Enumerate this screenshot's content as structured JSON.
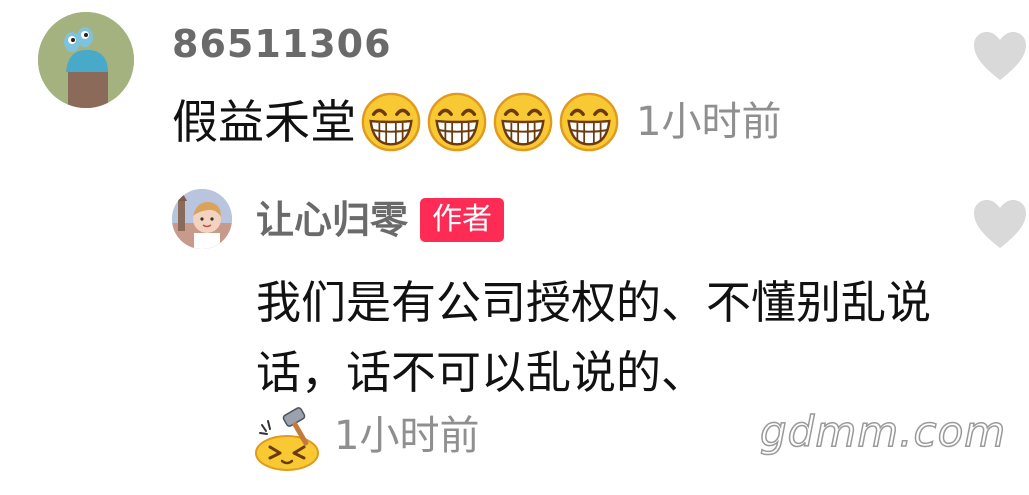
{
  "comment": {
    "username": "86511306",
    "text": "假益禾堂",
    "emoji_count": 4,
    "emoji_icon": "grinning-face-icon",
    "time": "1小时前",
    "like_icon": "heart-icon"
  },
  "reply": {
    "username": "让心归零",
    "author_badge": "作者",
    "text": "我们是有公司授权的、不懂别乱说话，话不可以乱说的、",
    "emoji_icon": "hammer-bonk-face-icon",
    "time": "1小时前",
    "like_icon": "heart-icon"
  },
  "watermark": "gdmm.com",
  "colors": {
    "username": "#6a6a6a",
    "time": "#8f8f8f",
    "badge": "#fe2c55",
    "heart": "#d9d9d9"
  }
}
